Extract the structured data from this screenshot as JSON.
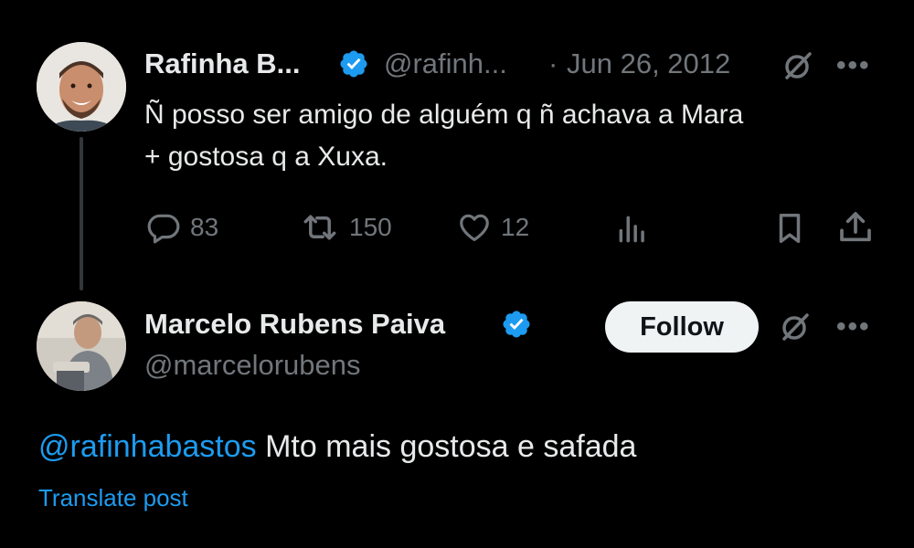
{
  "tweet1": {
    "display_name": "Rafinha B...",
    "handle": "@rafinh...",
    "separator": "·",
    "date": "Jun 26, 2012",
    "text_line1": "Ñ posso ser amigo de alguém q ñ achava a Mara",
    "text_line2": "+ gostosa q a Xuxa.",
    "replies": "83",
    "retweets": "150",
    "likes": "12",
    "icons": [
      "grok-icon",
      "more-icon",
      "reply-icon",
      "retweet-icon",
      "like-icon",
      "views-icon",
      "bookmark-icon",
      "share-icon"
    ]
  },
  "tweet2": {
    "display_name": "Marcelo Rubens Paiva",
    "handle": "@marcelorubens",
    "follow_label": "Follow",
    "mention": "@rafinhabastos",
    "text": " Mto mais gostosa e safada",
    "translate": "Translate post"
  },
  "colors": {
    "background": "#000000",
    "text": "#e7e9ea",
    "muted": "#71767b",
    "accent": "#1d9bf0",
    "follow_bg": "#eff3f4"
  }
}
